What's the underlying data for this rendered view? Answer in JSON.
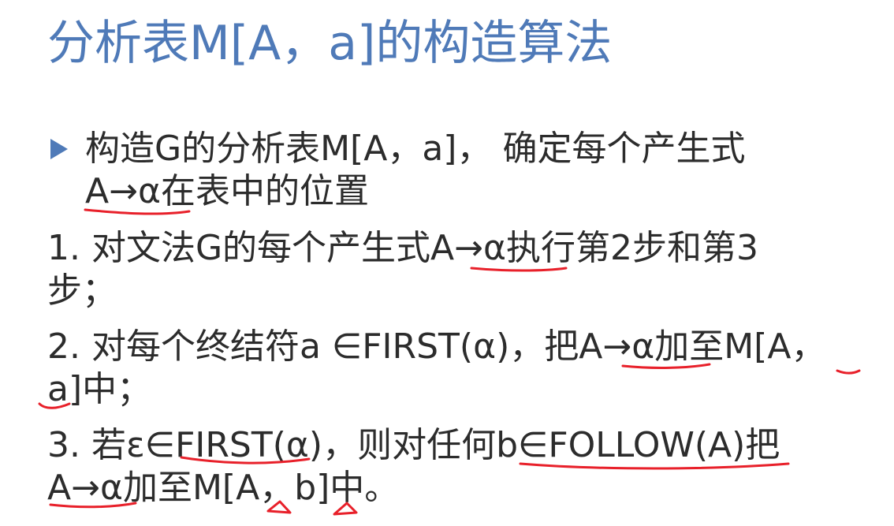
{
  "slide": {
    "title": "分析表M[A，a]的构造算法",
    "bullet_line1": "构造G的分析表M[A，a]， 确定每个产生式",
    "bullet_line2": "A→α在表中的位置",
    "step1_line1": "1. 对文法G的每个产生式A→α执行第2步和第3",
    "step1_line2": "步；",
    "step2_line1": "2. 对每个终结符a ∈FIRST(α)，把A→α加至M[A，",
    "step2_line2": "a]中；",
    "step3_line1": "3. 若ε∈FIRST(α)，则对任何b∈FOLLOW(A)把",
    "step3_line2": "A→α加至M[A，b]中。"
  },
  "colors": {
    "title": "#4f7ab8",
    "bullet_marker": "#4f7ab8",
    "body_text": "#2c2c2c",
    "annotation_ink": "#e8202a"
  }
}
